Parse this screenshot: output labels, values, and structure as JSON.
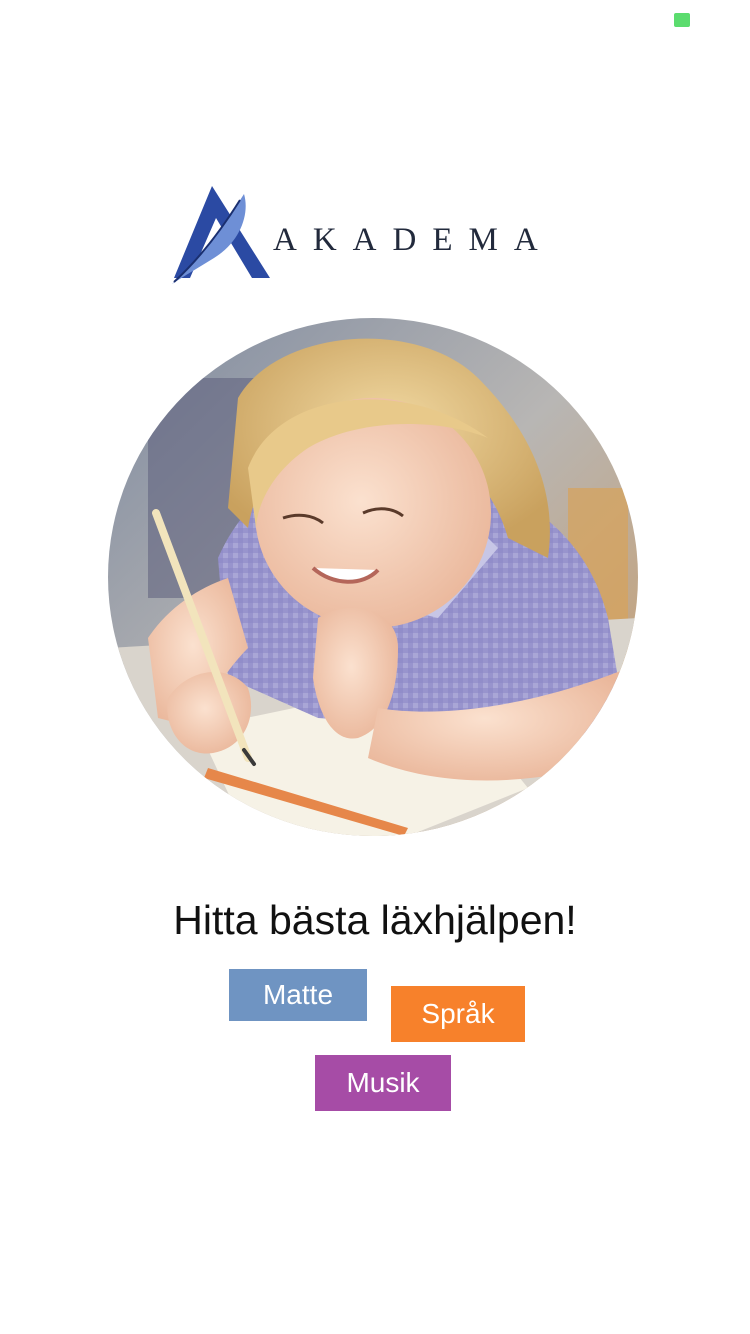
{
  "status": {
    "icon": "status-indicator",
    "color": "#5bdc6e"
  },
  "brand": {
    "name": "AKADEMA",
    "text_color": "#222a3c",
    "logo_colors": {
      "primary": "#2b4aa3",
      "dark": "#1a2f70",
      "light": "#6e8fd6"
    },
    "icon": "feather-a-logo"
  },
  "hero": {
    "subject": "girl-writing-photo"
  },
  "headline": {
    "text": "Hitta bästa läxhjälpen!"
  },
  "subjects": [
    {
      "label": "Matte",
      "color": "#6f94c2"
    },
    {
      "label": "Språk",
      "color": "#f7812b"
    },
    {
      "label": "Musik",
      "color": "#a64ca6"
    }
  ]
}
